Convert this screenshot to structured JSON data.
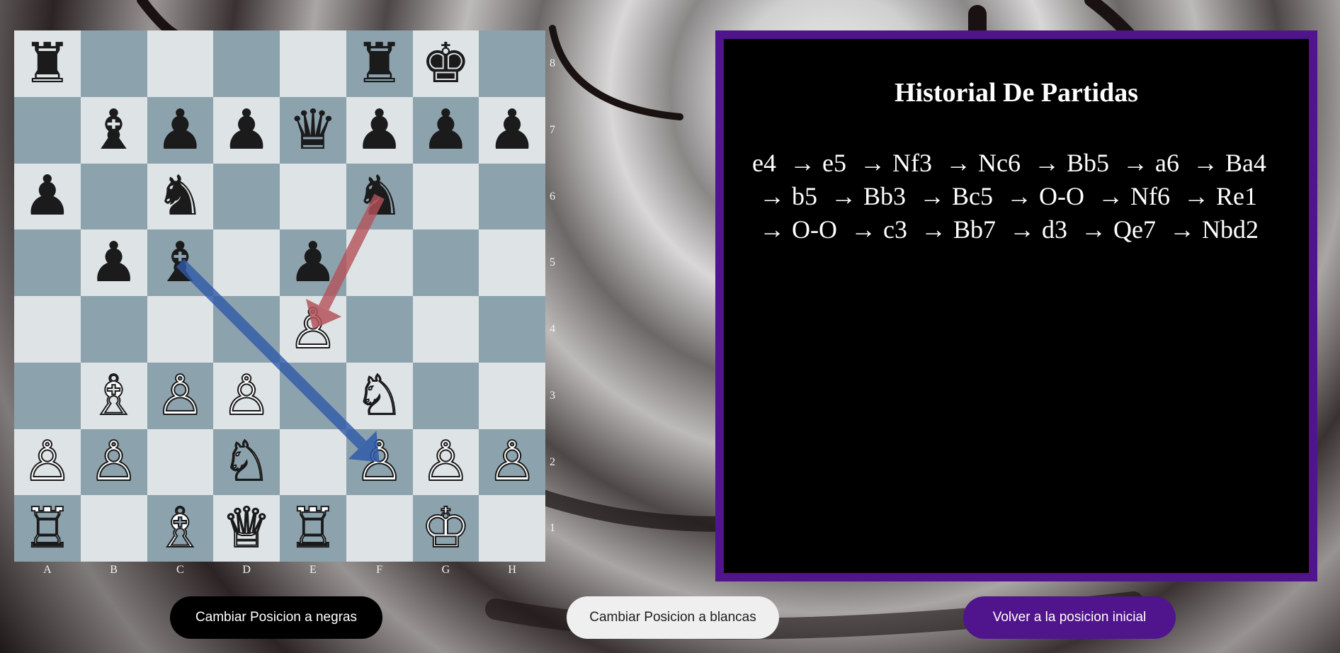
{
  "board": {
    "files": [
      "A",
      "B",
      "C",
      "D",
      "E",
      "F",
      "G",
      "H"
    ],
    "ranks": [
      "8",
      "7",
      "6",
      "5",
      "4",
      "3",
      "2",
      "1"
    ],
    "squares": [
      [
        {
          "p": "♜",
          "c": "black",
          "n": "black-rook"
        },
        {
          "p": "",
          "c": "",
          "n": ""
        },
        {
          "p": "",
          "c": "",
          "n": ""
        },
        {
          "p": "",
          "c": "",
          "n": ""
        },
        {
          "p": "",
          "c": "",
          "n": ""
        },
        {
          "p": "♜",
          "c": "black",
          "n": "black-rook"
        },
        {
          "p": "♚",
          "c": "black",
          "n": "black-king"
        },
        {
          "p": "",
          "c": "",
          "n": ""
        }
      ],
      [
        {
          "p": "",
          "c": "",
          "n": ""
        },
        {
          "p": "♝",
          "c": "black",
          "n": "black-bishop"
        },
        {
          "p": "♟",
          "c": "black",
          "n": "black-pawn"
        },
        {
          "p": "♟",
          "c": "black",
          "n": "black-pawn"
        },
        {
          "p": "♛",
          "c": "black",
          "n": "black-queen"
        },
        {
          "p": "♟",
          "c": "black",
          "n": "black-pawn"
        },
        {
          "p": "♟",
          "c": "black",
          "n": "black-pawn"
        },
        {
          "p": "♟",
          "c": "black",
          "n": "black-pawn"
        }
      ],
      [
        {
          "p": "♟",
          "c": "black",
          "n": "black-pawn"
        },
        {
          "p": "",
          "c": "",
          "n": ""
        },
        {
          "p": "♞",
          "c": "black",
          "n": "black-knight"
        },
        {
          "p": "",
          "c": "",
          "n": ""
        },
        {
          "p": "",
          "c": "",
          "n": ""
        },
        {
          "p": "♞",
          "c": "black",
          "n": "black-knight"
        },
        {
          "p": "",
          "c": "",
          "n": ""
        },
        {
          "p": "",
          "c": "",
          "n": ""
        }
      ],
      [
        {
          "p": "",
          "c": "",
          "n": ""
        },
        {
          "p": "♟",
          "c": "black",
          "n": "black-pawn"
        },
        {
          "p": "♝",
          "c": "black",
          "n": "black-bishop"
        },
        {
          "p": "",
          "c": "",
          "n": ""
        },
        {
          "p": "♟",
          "c": "black",
          "n": "black-pawn"
        },
        {
          "p": "",
          "c": "",
          "n": ""
        },
        {
          "p": "",
          "c": "",
          "n": ""
        },
        {
          "p": "",
          "c": "",
          "n": ""
        }
      ],
      [
        {
          "p": "",
          "c": "",
          "n": ""
        },
        {
          "p": "",
          "c": "",
          "n": ""
        },
        {
          "p": "",
          "c": "",
          "n": ""
        },
        {
          "p": "",
          "c": "",
          "n": ""
        },
        {
          "p": "♙",
          "c": "white",
          "n": "white-pawn"
        },
        {
          "p": "",
          "c": "",
          "n": ""
        },
        {
          "p": "",
          "c": "",
          "n": ""
        },
        {
          "p": "",
          "c": "",
          "n": ""
        }
      ],
      [
        {
          "p": "",
          "c": "",
          "n": ""
        },
        {
          "p": "♗",
          "c": "white",
          "n": "white-bishop"
        },
        {
          "p": "♙",
          "c": "white",
          "n": "white-pawn"
        },
        {
          "p": "♙",
          "c": "white",
          "n": "white-pawn"
        },
        {
          "p": "",
          "c": "",
          "n": ""
        },
        {
          "p": "♘",
          "c": "white",
          "n": "white-knight"
        },
        {
          "p": "",
          "c": "",
          "n": ""
        },
        {
          "p": "",
          "c": "",
          "n": ""
        }
      ],
      [
        {
          "p": "♙",
          "c": "white",
          "n": "white-pawn"
        },
        {
          "p": "♙",
          "c": "white",
          "n": "white-pawn"
        },
        {
          "p": "",
          "c": "",
          "n": ""
        },
        {
          "p": "♘",
          "c": "white",
          "n": "white-knight"
        },
        {
          "p": "",
          "c": "",
          "n": ""
        },
        {
          "p": "♙",
          "c": "white",
          "n": "white-pawn"
        },
        {
          "p": "♙",
          "c": "white",
          "n": "white-pawn"
        },
        {
          "p": "♙",
          "c": "white",
          "n": "white-pawn"
        }
      ],
      [
        {
          "p": "♖",
          "c": "white",
          "n": "white-rook"
        },
        {
          "p": "",
          "c": "",
          "n": ""
        },
        {
          "p": "♗",
          "c": "white",
          "n": "white-bishop"
        },
        {
          "p": "♕",
          "c": "white",
          "n": "white-queen"
        },
        {
          "p": "♖",
          "c": "white",
          "n": "white-rook"
        },
        {
          "p": "",
          "c": "",
          "n": ""
        },
        {
          "p": "♔",
          "c": "white",
          "n": "white-king"
        },
        {
          "p": "",
          "c": "",
          "n": ""
        }
      ]
    ],
    "arrows": [
      {
        "from": "f6",
        "to": "e4",
        "color": "#b5535a"
      },
      {
        "from": "c5",
        "to": "f2",
        "color": "#2f5aa8"
      }
    ],
    "light_color": "#dee3e6",
    "dark_color": "#8ca2ad"
  },
  "history": {
    "title": "Historial De Partidas",
    "separator": "→",
    "moves": [
      "e4",
      "e5",
      "Nf3",
      "Nc6",
      "Bb5",
      "a6",
      "Ba4",
      "b5",
      "Bb3",
      "Bc5",
      "O-O",
      "Nf6",
      "Re1",
      "O-O",
      "c3",
      "Bb7",
      "d3",
      "Qe7",
      "Nbd2"
    ],
    "border_color": "#50148c"
  },
  "buttons": {
    "black_view": "Cambiar Posicion a negras",
    "white_view": "Cambiar Posicion a blancas",
    "reset": "Volver a la posicion inicial"
  }
}
